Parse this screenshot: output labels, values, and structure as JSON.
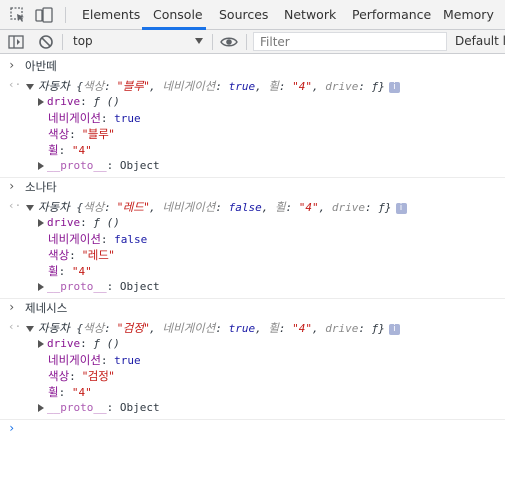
{
  "tabs": [
    "Elements",
    "Console",
    "Sources",
    "Network",
    "Performance",
    "Memory"
  ],
  "active_tab": "Console",
  "toolbar": {
    "context": "top",
    "filter_placeholder": "Filter",
    "levels_label": "Default le"
  },
  "entries": [
    {
      "input": "아반떼",
      "summary": {
        "cls": "자동차",
        "k1": "색상",
        "v1": "\"블루\"",
        "k2": "네비게이션",
        "v2": "true",
        "k3": "휠",
        "v3": "\"4\"",
        "k4": "drive",
        "v4": "ƒ"
      },
      "props": {
        "drive_key": "drive",
        "drive_val": "ƒ ()",
        "nav_key": "네비게이션",
        "nav_val": "true",
        "color_key": "색상",
        "color_val": "\"블루\"",
        "wheel_key": "휠",
        "wheel_val": "\"4\"",
        "proto_key": "__proto__",
        "proto_val": "Object"
      }
    },
    {
      "input": "소나타",
      "summary": {
        "cls": "자동차",
        "k1": "색상",
        "v1": "\"레드\"",
        "k2": "네비게이션",
        "v2": "false",
        "k3": "휠",
        "v3": "\"4\"",
        "k4": "drive",
        "v4": "ƒ"
      },
      "props": {
        "drive_key": "drive",
        "drive_val": "ƒ ()",
        "nav_key": "네비게이션",
        "nav_val": "false",
        "color_key": "색상",
        "color_val": "\"레드\"",
        "wheel_key": "휠",
        "wheel_val": "\"4\"",
        "proto_key": "__proto__",
        "proto_val": "Object"
      }
    },
    {
      "input": "제네시스",
      "summary": {
        "cls": "자동차",
        "k1": "색상",
        "v1": "\"검정\"",
        "k2": "네비게이션",
        "v2": "true",
        "k3": "휠",
        "v3": "\"4\"",
        "k4": "drive",
        "v4": "ƒ"
      },
      "props": {
        "drive_key": "drive",
        "drive_val": "ƒ ()",
        "nav_key": "네비게이션",
        "nav_val": "true",
        "color_key": "색상",
        "color_val": "\"검정\"",
        "wheel_key": "휠",
        "wheel_val": "\"4\"",
        "proto_key": "__proto__",
        "proto_val": "Object"
      }
    }
  ],
  "colors": {
    "accent": "#1a73e8",
    "key": "#881391",
    "string": "#c41a16",
    "boolean": "#1a1aa6"
  }
}
